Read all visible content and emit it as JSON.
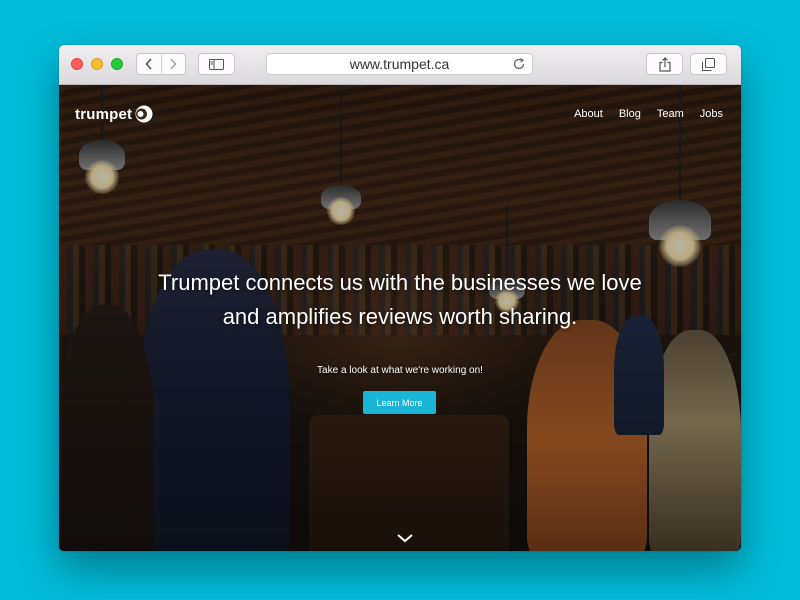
{
  "browser": {
    "url": "www.trumpet.ca"
  },
  "site": {
    "logo_text": "trumpet",
    "nav": [
      {
        "label": "About"
      },
      {
        "label": "Blog"
      },
      {
        "label": "Team"
      },
      {
        "label": "Jobs"
      }
    ],
    "hero": {
      "headline_line1": "Trumpet connects us with the businesses we love",
      "headline_line2": "and amplifies reviews worth sharing.",
      "subline": "Take a look at what we're working on!",
      "cta_label": "Learn More"
    }
  },
  "colors": {
    "background": "#00bcd8",
    "accent": "#1ab5d4"
  },
  "icons": [
    "close-dot",
    "minimize-dot",
    "zoom-dot",
    "back-chevron-icon",
    "forward-chevron-icon",
    "sidebar-icon",
    "reload-icon",
    "share-icon",
    "tabs-icon",
    "logo-moon-icon",
    "chevron-down-icon"
  ]
}
